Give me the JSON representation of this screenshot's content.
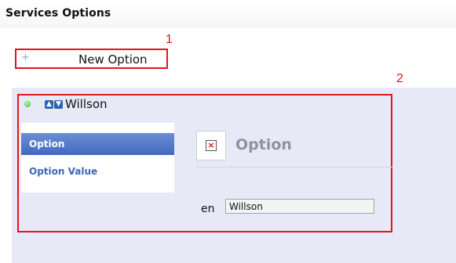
{
  "header": {
    "title": "Services Options"
  },
  "new_option": {
    "label": "New Option",
    "icon": "plus-icon"
  },
  "callouts": {
    "one": "1",
    "two": "2"
  },
  "item": {
    "name": "Willson"
  },
  "side_nav": {
    "items": [
      {
        "label": "Option",
        "active": true
      },
      {
        "label": "Option Value",
        "active": false
      }
    ]
  },
  "content": {
    "title": "Option",
    "language": "en",
    "name_value": "Willson"
  },
  "colors": {
    "highlight": "#e3141a",
    "panel": "#e7eaf6",
    "nav_active": "#4169c0",
    "link": "#3d66b8"
  }
}
